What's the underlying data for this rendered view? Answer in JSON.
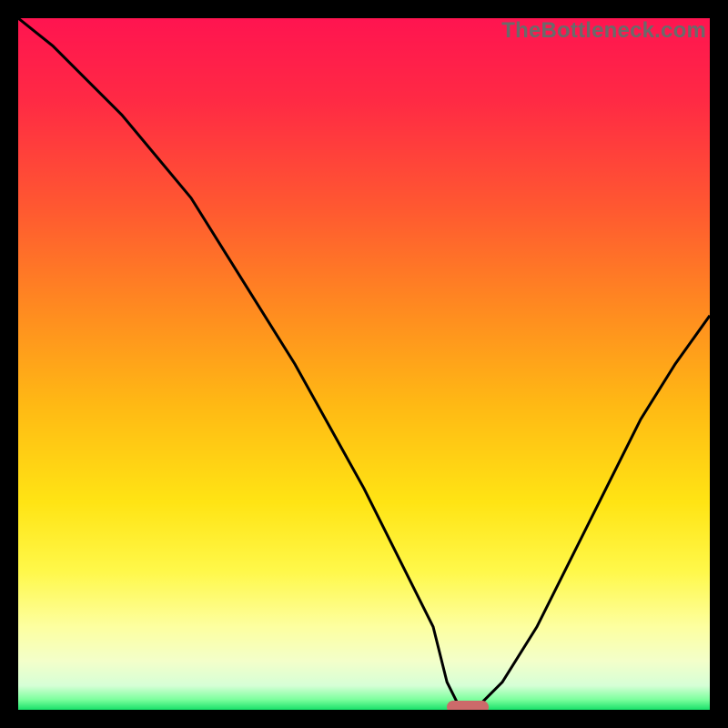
{
  "watermark": "TheBottleneck.com",
  "colors": {
    "frame": "#000000",
    "curve_stroke": "#000000",
    "pill": "#cc6a6a",
    "gradient_stops": [
      {
        "offset": 0.0,
        "color": "#ff1450"
      },
      {
        "offset": 0.12,
        "color": "#ff2a44"
      },
      {
        "offset": 0.28,
        "color": "#ff5a30"
      },
      {
        "offset": 0.42,
        "color": "#ff8a20"
      },
      {
        "offset": 0.56,
        "color": "#ffb914"
      },
      {
        "offset": 0.7,
        "color": "#ffe414"
      },
      {
        "offset": 0.8,
        "color": "#fff84a"
      },
      {
        "offset": 0.88,
        "color": "#fdffa0"
      },
      {
        "offset": 0.93,
        "color": "#f3ffca"
      },
      {
        "offset": 0.965,
        "color": "#d6ffd6"
      },
      {
        "offset": 0.985,
        "color": "#7dff9e"
      },
      {
        "offset": 1.0,
        "color": "#19e06a"
      }
    ]
  },
  "chart_data": {
    "type": "line",
    "title": "",
    "xlabel": "",
    "ylabel": "",
    "xlim": [
      0,
      100
    ],
    "ylim": [
      0,
      100
    ],
    "series": [
      {
        "name": "bottleneck-curve",
        "x": [
          0,
          5,
          10,
          15,
          20,
          25,
          30,
          35,
          40,
          45,
          50,
          55,
          60,
          62,
          64,
          66,
          70,
          75,
          80,
          85,
          90,
          95,
          100
        ],
        "y": [
          100,
          96,
          91,
          86,
          80,
          74,
          66,
          58,
          50,
          41,
          32,
          22,
          12,
          4,
          0,
          0,
          4,
          12,
          22,
          32,
          42,
          50,
          57
        ]
      }
    ],
    "marker": {
      "name": "optimal-range",
      "x_start": 62,
      "x_end": 68,
      "y": 0
    }
  }
}
